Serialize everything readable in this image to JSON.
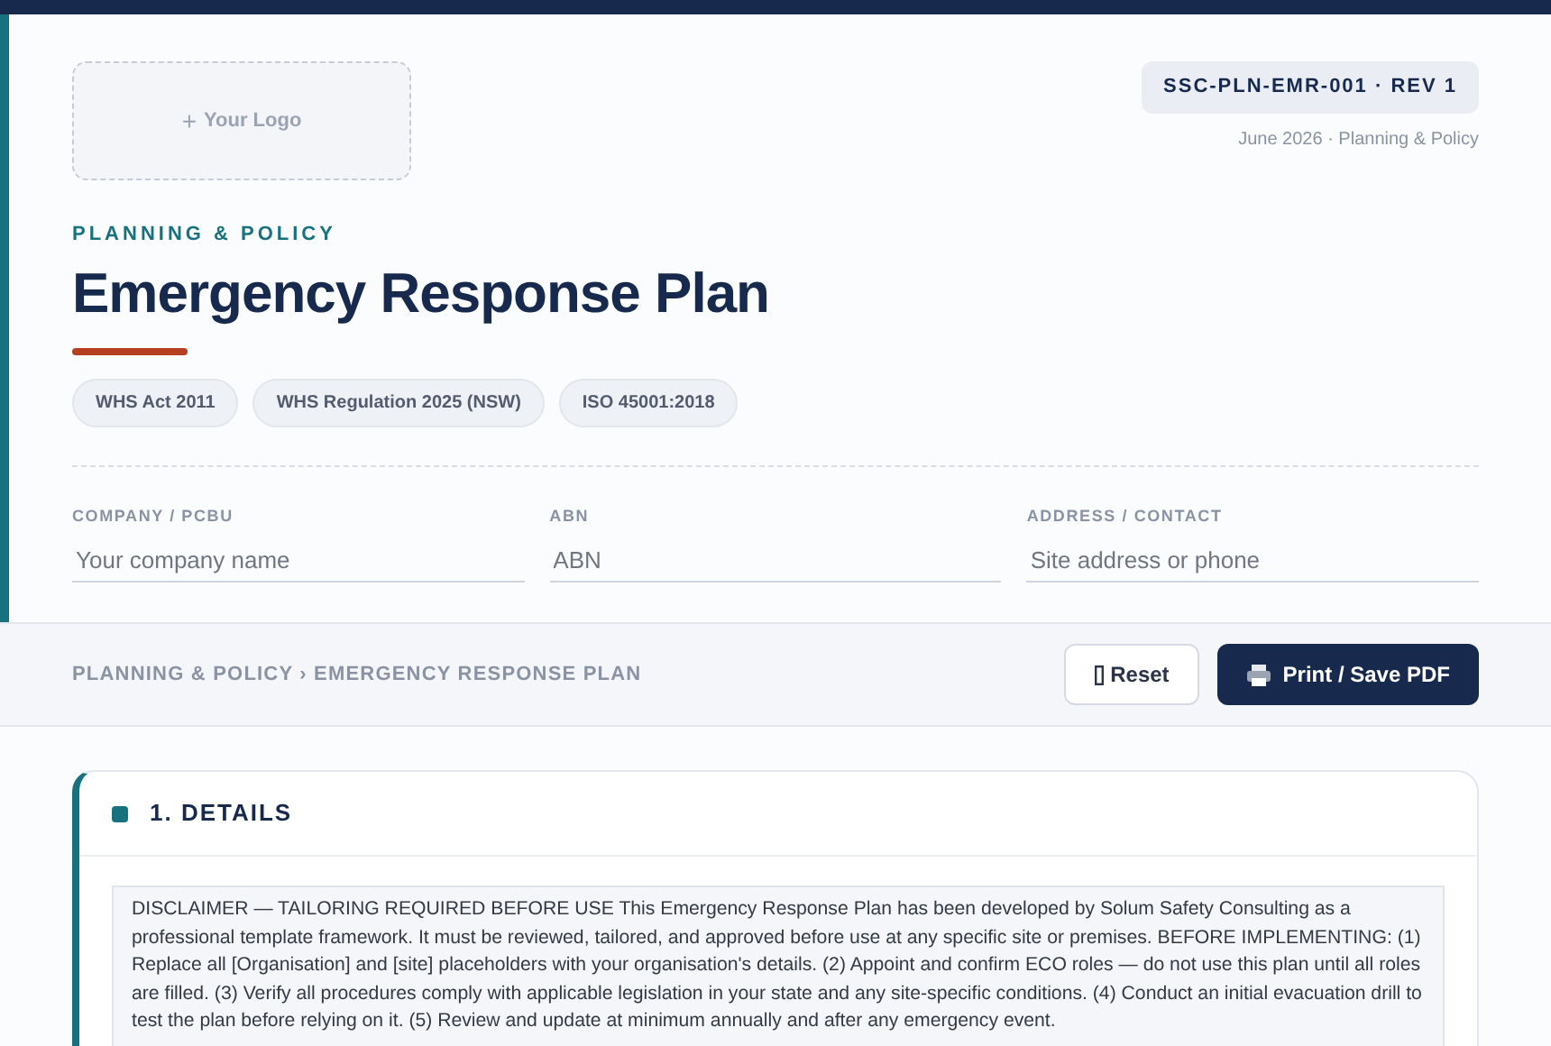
{
  "logo_placeholder": {
    "icon": "+",
    "label": "Your Logo"
  },
  "doc_code": "SSC-PLN-EMR-001 · REV 1",
  "doc_meta": "June 2026 · Planning & Policy",
  "category": "PLANNING & POLICY",
  "title": "Emergency Response Plan",
  "tags": [
    "WHS Act 2011",
    "WHS Regulation 2025 (NSW)",
    "ISO 45001:2018"
  ],
  "fields": [
    {
      "label": "COMPANY / PCBU",
      "placeholder": "Your company name"
    },
    {
      "label": "ABN",
      "placeholder": "ABN"
    },
    {
      "label": "ADDRESS / CONTACT",
      "placeholder": "Site address or phone"
    }
  ],
  "breadcrumb": "PLANNING & POLICY › EMERGENCY RESPONSE PLAN",
  "buttons": [
    {
      "kind": "reset",
      "label": "Reset"
    },
    {
      "kind": "print",
      "label": "Print / Save PDF"
    }
  ],
  "section": {
    "title": "1. DETAILS",
    "text": "DISCLAIMER — TAILORING REQUIRED BEFORE USE This Emergency Response Plan has been developed by Solum Safety Consulting as a professional template framework. It must be reviewed, tailored, and approved before use at any specific site or premises. BEFORE IMPLEMENTING: (1) Replace all [Organisation] and [site] placeholders with your organisation's details. (2) Appoint and confirm ECO roles — do not use this plan until all roles are filled. (3) Verify all procedures comply with applicable legislation in your state and any site-specific conditions. (4) Conduct an initial evacuation drill to test the plan before relying on it. (5) Review and update at minimum annually and after any emergency event."
  }
}
